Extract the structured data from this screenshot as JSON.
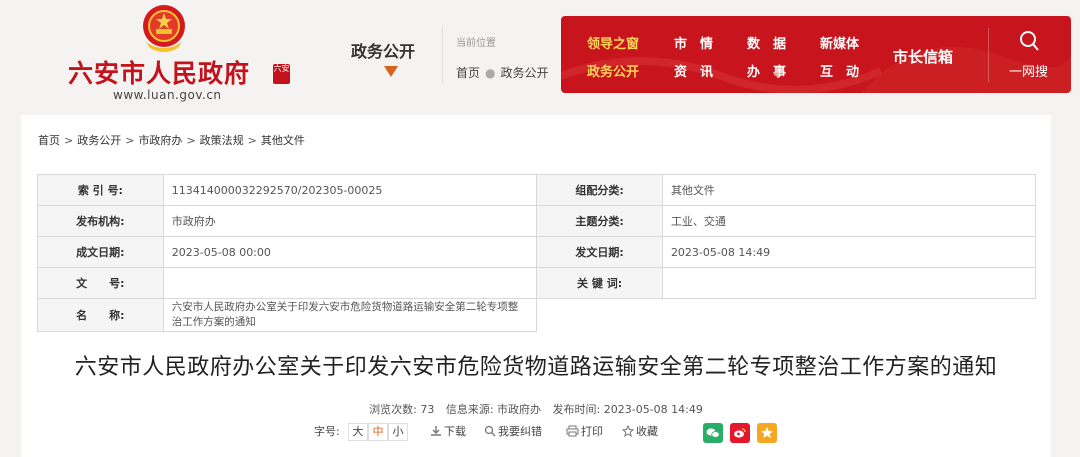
{
  "header": {
    "site_name": "六安市人民政府",
    "site_url": "www.luan.gov.cn",
    "section": "政务公开",
    "location_title": "当前位置",
    "location_home": "首页",
    "location_current": "政务公开",
    "seal_text": "六安"
  },
  "nav": {
    "items": [
      {
        "label": "领导之窗",
        "active": false
      },
      {
        "label": "市　情",
        "active": false
      },
      {
        "label": "数　据",
        "active": false
      },
      {
        "label": "新媒体",
        "active": false
      },
      {
        "label": "市长信箱",
        "active": false
      },
      {
        "label": "政务公开",
        "active": true
      },
      {
        "label": "资　讯",
        "active": false
      },
      {
        "label": "办　事",
        "active": false
      },
      {
        "label": "互　动",
        "active": false
      }
    ],
    "search_label": "一网搜"
  },
  "breadcrumb": [
    "首页",
    "政务公开",
    "市政府办",
    "政策法规",
    "其他文件"
  ],
  "info": {
    "index_no_label": "索 引 号:",
    "index_no": "113414000032292570/202305-00025",
    "category_label": "组配分类:",
    "category": "其他文件",
    "publisher_label": "发布机构:",
    "publisher": "市政府办",
    "topic_label": "主题分类:",
    "topic": "工业、交通",
    "created_label": "成文日期:",
    "created": "2023-05-08 00:00",
    "published_label": "发文日期:",
    "published": "2023-05-08 14:49",
    "doc_no_label": "文　　号:",
    "doc_no": "",
    "keywords_label": "关 键 词:",
    "keywords": "",
    "name_label": "名　　称:",
    "name": "六安市人民政府办公室关于印发六安市危险货物道路运输安全第二轮专项整治工作方案的通知"
  },
  "document": {
    "title": "六安市人民政府办公室关于印发六安市危险货物道路运输安全第二轮专项整治工作方案的通知",
    "views": "浏览次数: 73",
    "source": "信息来源: 市政府办",
    "publish_time": "发布时间: 2023-05-08 14:49"
  },
  "tools": {
    "font_label": "字号:",
    "size_large": "大",
    "size_medium": "中",
    "size_small": "小",
    "download": "下载",
    "correct": "我要纠错",
    "print": "打印",
    "favorite": "收藏"
  },
  "colors": {
    "brand_red": "#c8141d",
    "nav_gold": "#ffd45a",
    "accent_orange": "#d8641c",
    "wechat": "#2aae67",
    "weibo": "#e6162d",
    "qzone": "#f5a623"
  }
}
